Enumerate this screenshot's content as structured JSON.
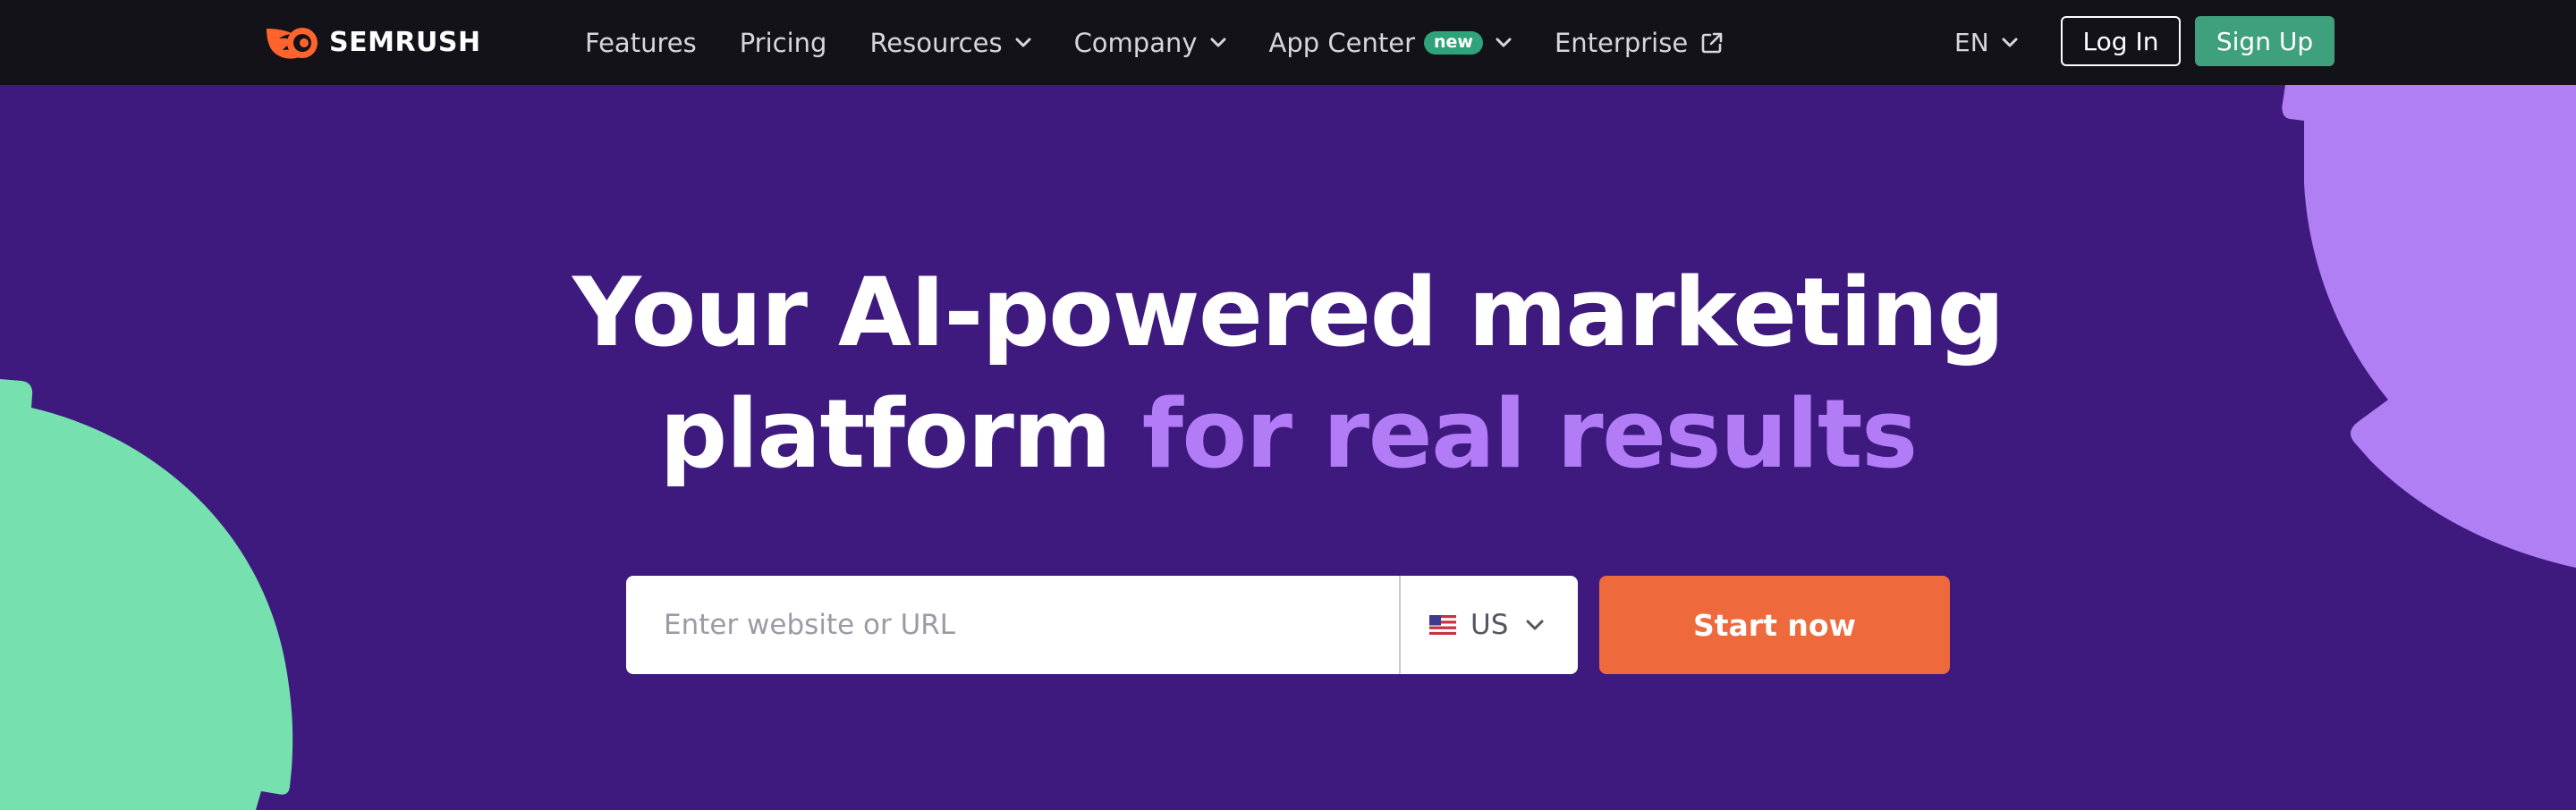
{
  "brand": {
    "name": "SEMRUSH",
    "logo_icon": "semrush-fire-icon",
    "logo_color": "#ff642d"
  },
  "nav": {
    "items": [
      {
        "label": "Features",
        "has_dropdown": false
      },
      {
        "label": "Pricing",
        "has_dropdown": false
      },
      {
        "label": "Resources",
        "has_dropdown": true
      },
      {
        "label": "Company",
        "has_dropdown": true
      },
      {
        "label": "App Center",
        "has_dropdown": true,
        "badge": "new"
      },
      {
        "label": "Enterprise",
        "external_link": true
      }
    ],
    "language": "EN",
    "login_label": "Log In",
    "signup_label": "Sign Up"
  },
  "hero": {
    "title_line1": "Your AI-powered marketing",
    "title_line2_plain": "platform ",
    "title_line2_accent": "for real results"
  },
  "search": {
    "placeholder": "Enter website or URL",
    "value": "",
    "country_code": "US",
    "country_flag_icon": "us-flag-icon",
    "submit_label": "Start now"
  },
  "colors": {
    "background": "#3e1a7e",
    "nav_background": "#131218",
    "accent_text": "#b17cf5",
    "cta": "#ee6a3c",
    "signup": "#3fa07d",
    "badge": "#2fa37a",
    "deco_purple": "#b07ff4",
    "deco_green": "#76e0ae"
  }
}
